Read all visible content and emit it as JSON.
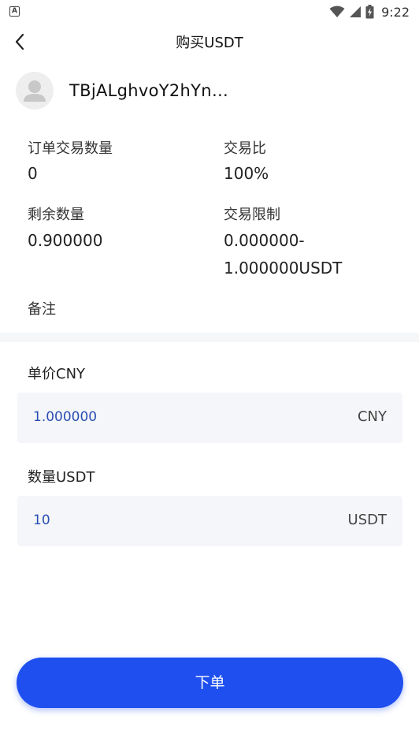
{
  "status_bar": {
    "app_badge": "A",
    "time": "9:22"
  },
  "header": {
    "title": "购买USDT",
    "back_icon": "chevron-left-icon"
  },
  "seller": {
    "name": "TBjALghvoY2hYn…",
    "avatar_icon": "user-avatar-icon"
  },
  "order_info": {
    "order_qty_label": "订单交易数量",
    "order_qty_value": "0",
    "ratio_label": "交易比",
    "ratio_value": "100%",
    "remaining_label": "剩余数量",
    "remaining_value": "0.900000",
    "limit_label": "交易限制",
    "limit_value_line1": "0.000000-",
    "limit_value_line2": "1.000000USDT",
    "remark_label": "备注"
  },
  "form": {
    "price_label": "单价CNY",
    "price_value": "1.000000",
    "price_unit": "CNY",
    "amount_label": "数量USDT",
    "amount_value": "10",
    "amount_unit": "USDT"
  },
  "actions": {
    "submit_label": "下单"
  },
  "colors": {
    "accent": "#1f4fef",
    "input_value": "#2a4fb3",
    "field_bg": "#f5f6f9"
  }
}
